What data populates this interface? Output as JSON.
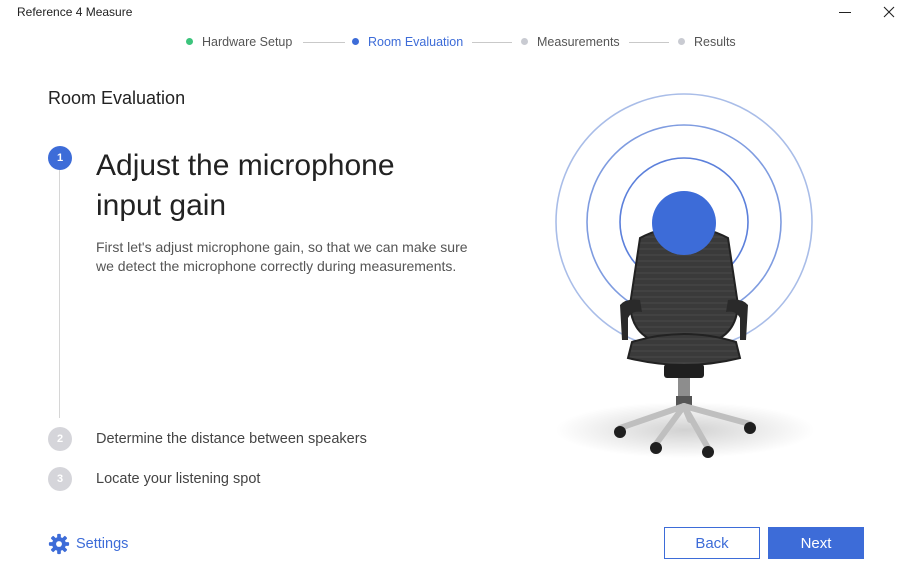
{
  "window": {
    "title": "Reference 4 Measure",
    "minimize_icon": "minimize-icon",
    "close_icon": "close-icon"
  },
  "progress": {
    "steps": [
      {
        "label": "Hardware Setup",
        "state": "completed",
        "color": "#3cc47c"
      },
      {
        "label": "Room Evaluation",
        "state": "active",
        "color": "#3d6cd8"
      },
      {
        "label": "Measurements",
        "state": "pending",
        "color": "#c9cbd2"
      },
      {
        "label": "Results",
        "state": "pending",
        "color": "#c9cbd2"
      }
    ]
  },
  "section": {
    "title": "Room Evaluation"
  },
  "steps": [
    {
      "number": "1",
      "title": "Adjust the microphone input gain",
      "description": "First let's adjust microphone gain, so that we can make sure we detect the microphone correctly during measurements.",
      "state": "active"
    },
    {
      "number": "2",
      "title": "Determine the distance between speakers",
      "state": "pending"
    },
    {
      "number": "3",
      "title": "Locate your listening spot",
      "state": "pending"
    }
  ],
  "illustration": {
    "name": "office-chair-with-sound-rings"
  },
  "footer": {
    "settings_label": "Settings",
    "settings_icon": "gear-icon",
    "back_label": "Back",
    "next_label": "Next"
  },
  "colors": {
    "accent": "#3d6cd8",
    "completed": "#3cc47c",
    "inactive": "#c9cbd2"
  }
}
